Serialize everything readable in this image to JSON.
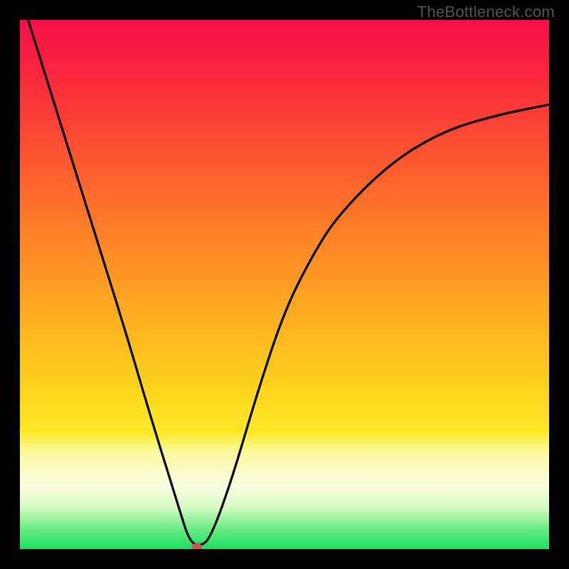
{
  "watermark": "TheBottleneck.com",
  "colors": {
    "bg": "#000000",
    "curve": "#000000",
    "marker": "#c9565a",
    "gradient_top": "#f50f49",
    "gradient_mid": "#fdd41e",
    "gradient_bottom": "#18e060"
  },
  "chart_data": {
    "type": "line",
    "title": "",
    "xlabel": "",
    "ylabel": "",
    "xlim": [
      0,
      1
    ],
    "ylim": [
      0,
      1
    ],
    "series": [
      {
        "name": "bottleneck-curve",
        "x": [
          0.0,
          0.05,
          0.1,
          0.15,
          0.2,
          0.25,
          0.3,
          0.32,
          0.34,
          0.36,
          0.4,
          0.45,
          0.5,
          0.55,
          0.6,
          0.7,
          0.8,
          0.9,
          1.0
        ],
        "y": [
          1.05,
          0.89,
          0.73,
          0.57,
          0.41,
          0.24,
          0.08,
          0.015,
          0.005,
          0.02,
          0.13,
          0.3,
          0.45,
          0.55,
          0.63,
          0.73,
          0.79,
          0.82,
          0.84
        ]
      }
    ],
    "marker": {
      "x": 0.335,
      "y": 0.004
    },
    "annotations": []
  }
}
